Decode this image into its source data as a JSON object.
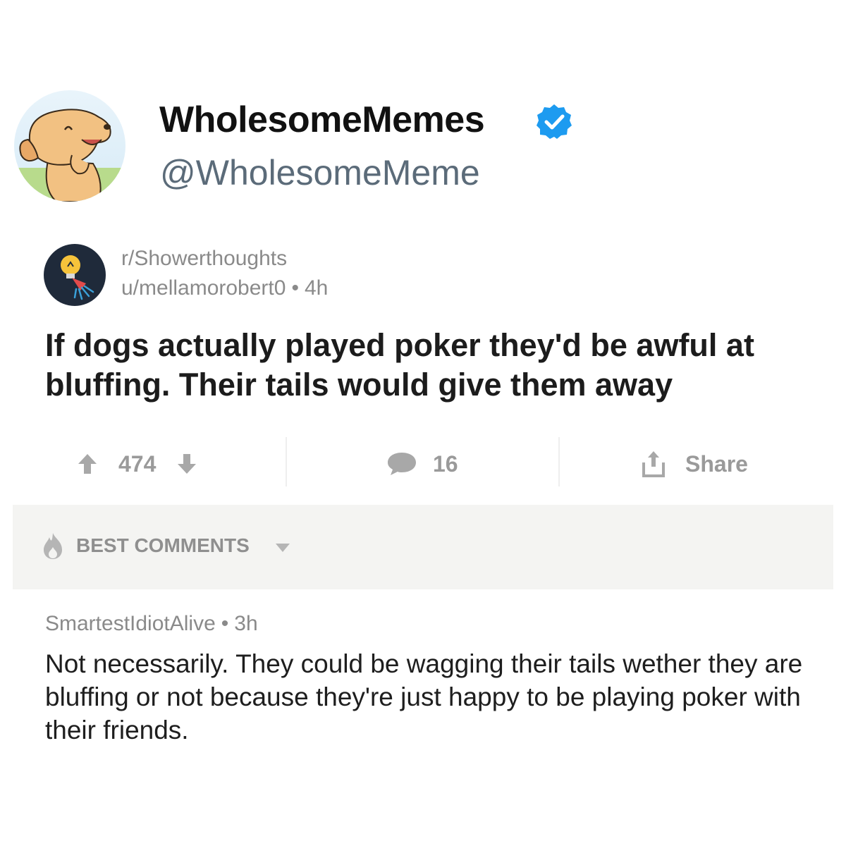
{
  "account": {
    "display_name": "WholesomeMemes",
    "handle": "@WholesomeMeme",
    "avatar_icon": "cartoon-dog-avatar",
    "verified_icon": "verified-badge-icon",
    "verified_color": "#1d9bf0"
  },
  "post": {
    "subreddit": "r/Showerthoughts",
    "author": "u/mellamorobert0",
    "separator": "•",
    "age": "4h",
    "subreddit_icon": "lightbulb-shower-icon",
    "title": "If dogs actually played poker they'd be awful at bluffing. Their tails would give them away"
  },
  "actions": {
    "score": "474",
    "comments": "16",
    "share_label": "Share",
    "upvote_icon": "upvote-arrow-icon",
    "downvote_icon": "downvote-arrow-icon",
    "comment_icon": "comment-bubble-icon",
    "share_icon": "share-icon"
  },
  "comments_section": {
    "sort_label": "BEST COMMENTS",
    "sort_icon": "flame-icon",
    "dropdown_icon": "caret-down-icon"
  },
  "top_comment": {
    "author": "SmartestIdiotAlive",
    "separator": "•",
    "age": "3h",
    "body": "Not necessarily. They could be wagging their tails wether they are bluffing or not because they're just happy to be playing poker with their friends."
  },
  "colors": {
    "muted_text": "#8a8a8a",
    "handle_text": "#5b6b79",
    "comments_bar_bg": "#f4f4f2"
  }
}
